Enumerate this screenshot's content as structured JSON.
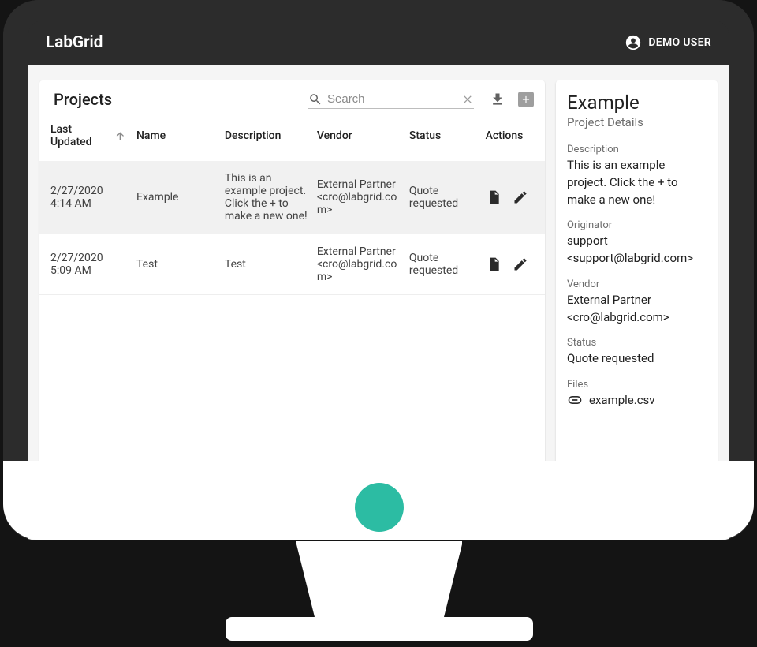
{
  "appbar": {
    "brand": "LabGrid",
    "user_label": "DEMO USER"
  },
  "projects": {
    "title": "Projects",
    "search_placeholder": "Search",
    "columns": {
      "last_updated": "Last Updated",
      "name": "Name",
      "description": "Description",
      "vendor": "Vendor",
      "status": "Status",
      "actions": "Actions"
    },
    "rows": [
      {
        "last_updated": "2/27/2020 4:14 AM",
        "name": "Example",
        "description": "This is an example project. Click the + to make a new one!",
        "vendor": "External Partner <cro@labgrid.com>",
        "status": "Quote requested",
        "selected": true
      },
      {
        "last_updated": "2/27/2020 5:09 AM",
        "name": "Test",
        "description": "Test",
        "vendor": "External Partner <cro@labgrid.com>",
        "status": "Quote requested",
        "selected": false
      }
    ]
  },
  "details": {
    "title": "Example",
    "subtitle": "Project Details",
    "labels": {
      "description": "Description",
      "originator": "Originator",
      "vendor": "Vendor",
      "status": "Status",
      "files": "Files"
    },
    "description": "This is an example project. Click the + to make a new one!",
    "originator": "support <support@labgrid.com>",
    "vendor": "External Partner <cro@labgrid.com>",
    "status": "Quote requested",
    "files": [
      {
        "name": "example.csv"
      }
    ]
  },
  "colors": {
    "accent": "#2cbca3"
  }
}
